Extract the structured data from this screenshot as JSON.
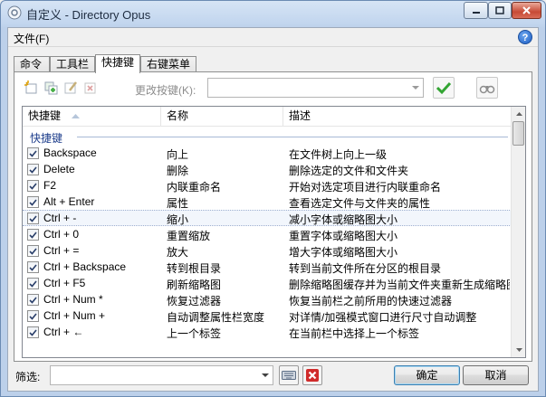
{
  "window": {
    "title": "自定义 - Directory Opus"
  },
  "menu": {
    "file": "文件(F)"
  },
  "tabs": [
    "命令",
    "工具栏",
    "快捷键",
    "右键菜单"
  ],
  "toolbar": {
    "change_hotkey_label": "更改按键(K):",
    "hotkey_value": ""
  },
  "table": {
    "columns": [
      "快捷键",
      "名称",
      "描述"
    ],
    "group": "快捷键",
    "rows": [
      {
        "key": "Backspace",
        "name": "向上",
        "desc": "在文件树上向上一级"
      },
      {
        "key": "Delete",
        "name": "删除",
        "desc": "删除选定的文件和文件夹"
      },
      {
        "key": "F2",
        "name": "内联重命名",
        "desc": "开始对选定项目进行内联重命名"
      },
      {
        "key": "Alt + Enter",
        "name": "属性",
        "desc": "查看选定文件与文件夹的属性"
      },
      {
        "key": "Ctrl + -",
        "name": "缩小",
        "desc": "减小字体或缩略图大小"
      },
      {
        "key": "Ctrl + 0",
        "name": "重置缩放",
        "desc": "重置字体或缩略图大小"
      },
      {
        "key": "Ctrl + =",
        "name": "放大",
        "desc": "增大字体或缩略图大小"
      },
      {
        "key": "Ctrl + Backspace",
        "name": "转到根目录",
        "desc": "转到当前文件所在分区的根目录"
      },
      {
        "key": "Ctrl + F5",
        "name": "刷新缩略图",
        "desc": "删除缩略图缓存并为当前文件夹重新生成缩略图"
      },
      {
        "key": "Ctrl + Num *",
        "name": "恢复过滤器",
        "desc": "恢复当前栏之前所用的快速过滤器"
      },
      {
        "key": "Ctrl + Num +",
        "name": "自动调整属性栏宽度",
        "desc": "对详情/加强模式窗口进行尺寸自动调整"
      },
      {
        "key": "Ctrl + ←",
        "name": "上一个标签",
        "desc": "在当前栏中选择上一个标签"
      }
    ]
  },
  "filter": {
    "label": "筛选:",
    "value": ""
  },
  "buttons": {
    "ok": "确定",
    "cancel": "取消"
  },
  "colors": {
    "accent": "#3c7fb1",
    "group_text": "#1e3e8c",
    "ok_check": "#33a533",
    "delete_red": "#d02b2b"
  }
}
